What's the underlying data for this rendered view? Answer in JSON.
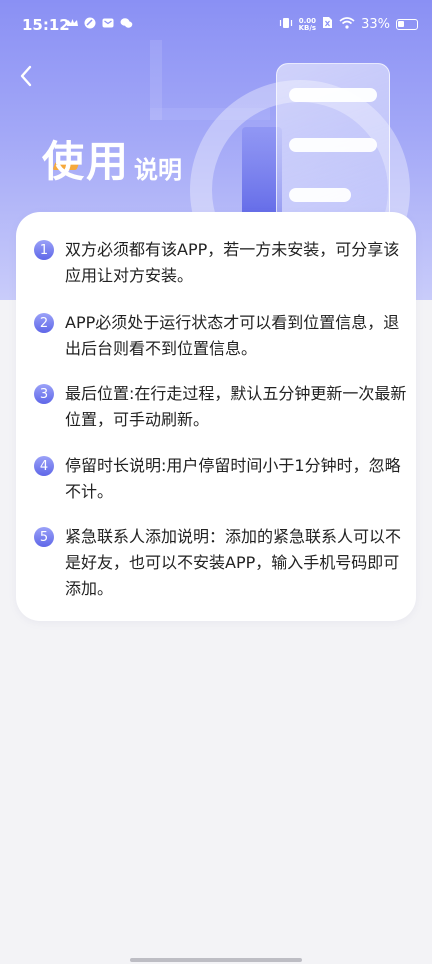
{
  "status_bar": {
    "time": "15:12",
    "net_speed_value": "0.00",
    "net_speed_unit": "KB/s",
    "battery": "33%"
  },
  "header": {
    "title_main": "使用",
    "title_sub": "说明",
    "back_icon": "chevron-left-icon"
  },
  "instructions": [
    {
      "index": "1",
      "text": "双方必须都有该APP，若一方未安装，可分享该应用让对方安装。"
    },
    {
      "index": "2",
      "text": "APP必须处于运行状态才可以看到位置信息，退出后台则看不到位置信息。"
    },
    {
      "index": "3",
      "text": "最后位置:在行走过程，默认五分钟更新一次最新位置，可手动刷新。"
    },
    {
      "index": "4",
      "text": "停留时长说明:用户停留时间小于1分钟时，忽略不计。"
    },
    {
      "index": "5",
      "text": "紧急联系人添加说明：添加的紧急联系人可以不是好友，也可以不安装APP，输入手机号码即可添加。"
    }
  ],
  "colors": {
    "hero_top": "#8a90f4",
    "accent": "#5f67e8",
    "title_accent": "#f6a93b"
  }
}
